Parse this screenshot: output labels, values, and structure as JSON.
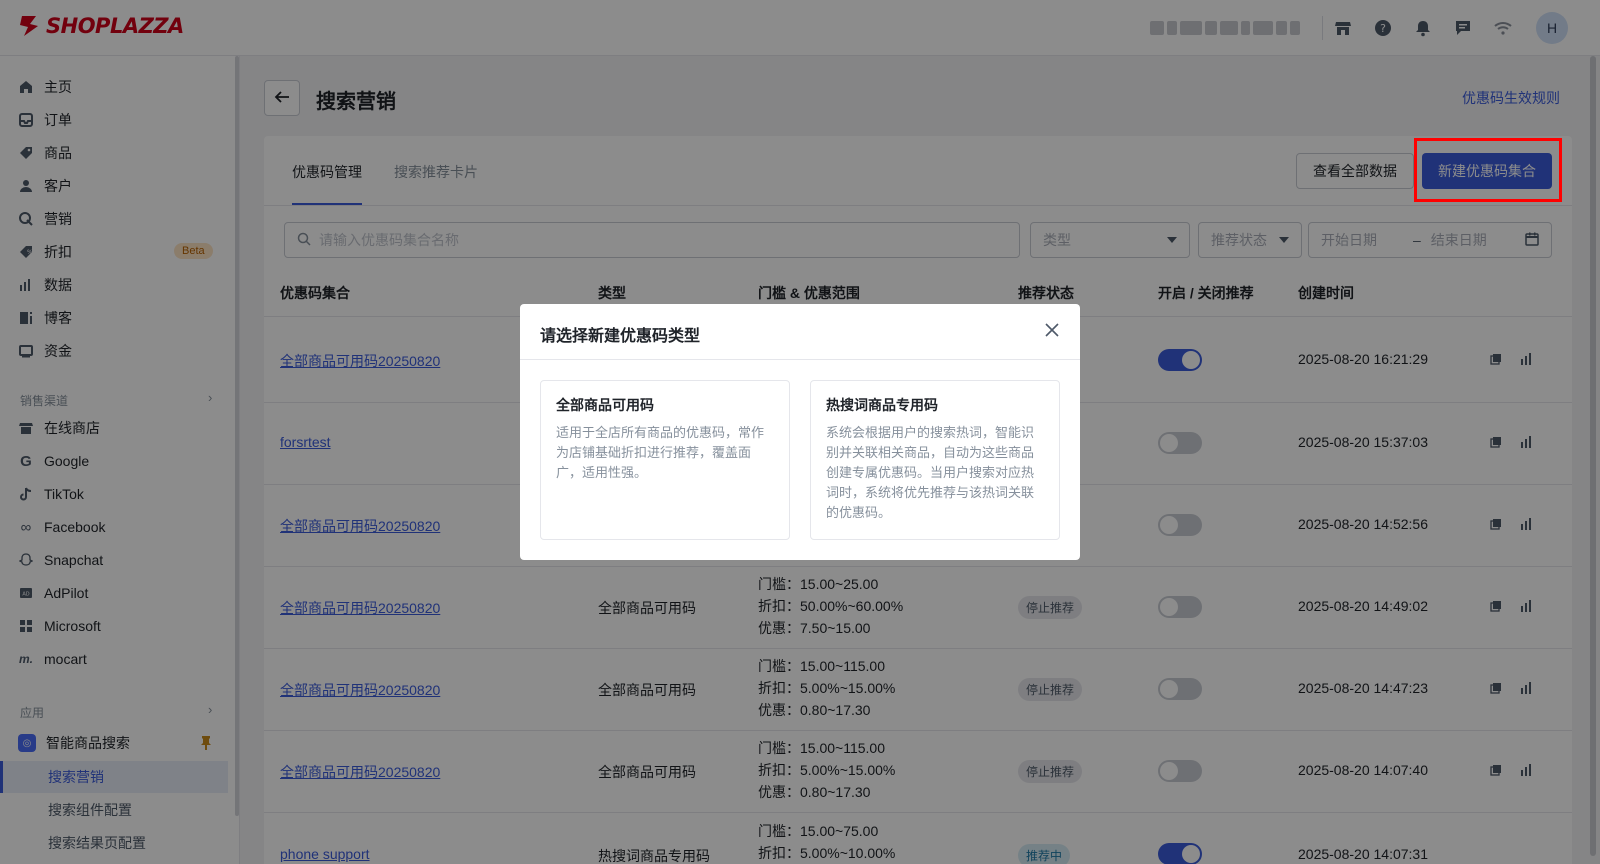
{
  "brand": {
    "name": "SHOPLAZZA",
    "color": "#d0021b"
  },
  "topbar": {
    "icons": [
      "store-icon",
      "help-icon",
      "bell-icon",
      "chat-icon",
      "wifi-icon"
    ],
    "avatar": "H"
  },
  "sidebar": {
    "items": [
      {
        "label": "主页",
        "icon": "home-icon"
      },
      {
        "label": "订单",
        "icon": "inbox-icon"
      },
      {
        "label": "商品",
        "icon": "tag-icon"
      },
      {
        "label": "客户",
        "icon": "user-icon"
      },
      {
        "label": "营销",
        "icon": "marketing-icon"
      },
      {
        "label": "折扣",
        "icon": "discount-icon",
        "badge": "Beta"
      },
      {
        "label": "数据",
        "icon": "chart-icon"
      },
      {
        "label": "博客",
        "icon": "blog-icon"
      },
      {
        "label": "资金",
        "icon": "wallet-icon"
      }
    ],
    "sales_channels_title": "销售渠道",
    "channels": [
      {
        "label": "在线商店",
        "icon": "store-icon"
      },
      {
        "label": "Google",
        "icon": "google-icon"
      },
      {
        "label": "TikTok",
        "icon": "tiktok-icon"
      },
      {
        "label": "Facebook",
        "icon": "meta-icon"
      },
      {
        "label": "Snapchat",
        "icon": "snapchat-icon"
      },
      {
        "label": "AdPilot",
        "icon": "adpilot-icon"
      },
      {
        "label": "Microsoft",
        "icon": "microsoft-icon"
      },
      {
        "label": "mocart",
        "icon": "mocart-icon"
      }
    ],
    "apps_title": "应用",
    "app": {
      "label": "智能商品搜索",
      "icon": "search-app-icon"
    },
    "sub_items": [
      "搜索营销",
      "搜索组件配置",
      "搜索结果页配置"
    ]
  },
  "page": {
    "title": "搜索营销",
    "rule_link": "优惠码生效规则",
    "tabs": [
      "优惠码管理",
      "搜索推荐卡片"
    ],
    "view_all_button": "查看全部数据",
    "new_button": "新建优惠码集合"
  },
  "filters": {
    "search_placeholder": "请输入优惠码集合名称",
    "type_placeholder": "类型",
    "status_placeholder": "推荐状态",
    "start_date": "开始日期",
    "date_sep": "–",
    "end_date": "结束日期"
  },
  "table": {
    "headers": [
      "优惠码集合",
      "类型",
      "门槛 & 优惠范围",
      "推荐状态",
      "开启 / 关闭推荐",
      "创建时间"
    ],
    "rows": [
      {
        "name": "全部商品可用码20250820",
        "type": "",
        "range": [],
        "status": "",
        "enabled": true,
        "created": "2025-08-20 16:21:29"
      },
      {
        "name": "forsrtest",
        "type": "",
        "range": [],
        "status": "",
        "enabled": false,
        "created": "2025-08-20 15:37:03"
      },
      {
        "name": "全部商品可用码20250820",
        "type": "",
        "range": [],
        "status": "",
        "enabled": false,
        "created": "2025-08-20 14:52:56"
      },
      {
        "name": "全部商品可用码20250820",
        "type": "全部商品可用码",
        "range": [
          "门槛：15.00~25.00",
          "折扣：50.00%~60.00%",
          "优惠：7.50~15.00"
        ],
        "status": "停止推荐",
        "enabled": false,
        "created": "2025-08-20 14:49:02"
      },
      {
        "name": "全部商品可用码20250820",
        "type": "全部商品可用码",
        "range": [
          "门槛：15.00~115.00",
          "折扣：5.00%~15.00%",
          "优惠：0.80~17.30"
        ],
        "status": "停止推荐",
        "enabled": false,
        "created": "2025-08-20 14:47:23"
      },
      {
        "name": "全部商品可用码20250820",
        "type": "全部商品可用码",
        "range": [
          "门槛：15.00~115.00",
          "折扣：5.00%~15.00%",
          "优惠：0.80~17.30"
        ],
        "status": "停止推荐",
        "enabled": false,
        "created": "2025-08-20 14:07:40"
      },
      {
        "name": "phone support",
        "type": "热搜词商品专用码",
        "range": [
          "门槛：15.00~75.00",
          "折扣：5.00%~10.00%"
        ],
        "status": "推荐中",
        "enabled": true,
        "created": "2025-08-20 14:07:31"
      }
    ]
  },
  "modal": {
    "title": "请选择新建优惠码类型",
    "options": [
      {
        "title": "全部商品可用码",
        "desc": "适用于全店所有商品的优惠码，常作为店铺基础折扣进行推荐，覆盖面广，适用性强。"
      },
      {
        "title": "热搜词商品专用码",
        "desc": "系统会根据用户的搜索热词，智能识别并关联相关商品，自动为这些商品创建专属优惠码。当用户搜索对应热词时，系统将优先推荐与该热词关联的优惠码。"
      }
    ]
  },
  "colors": {
    "primary": "#3b5bdb",
    "highlight": "#ff0000"
  }
}
